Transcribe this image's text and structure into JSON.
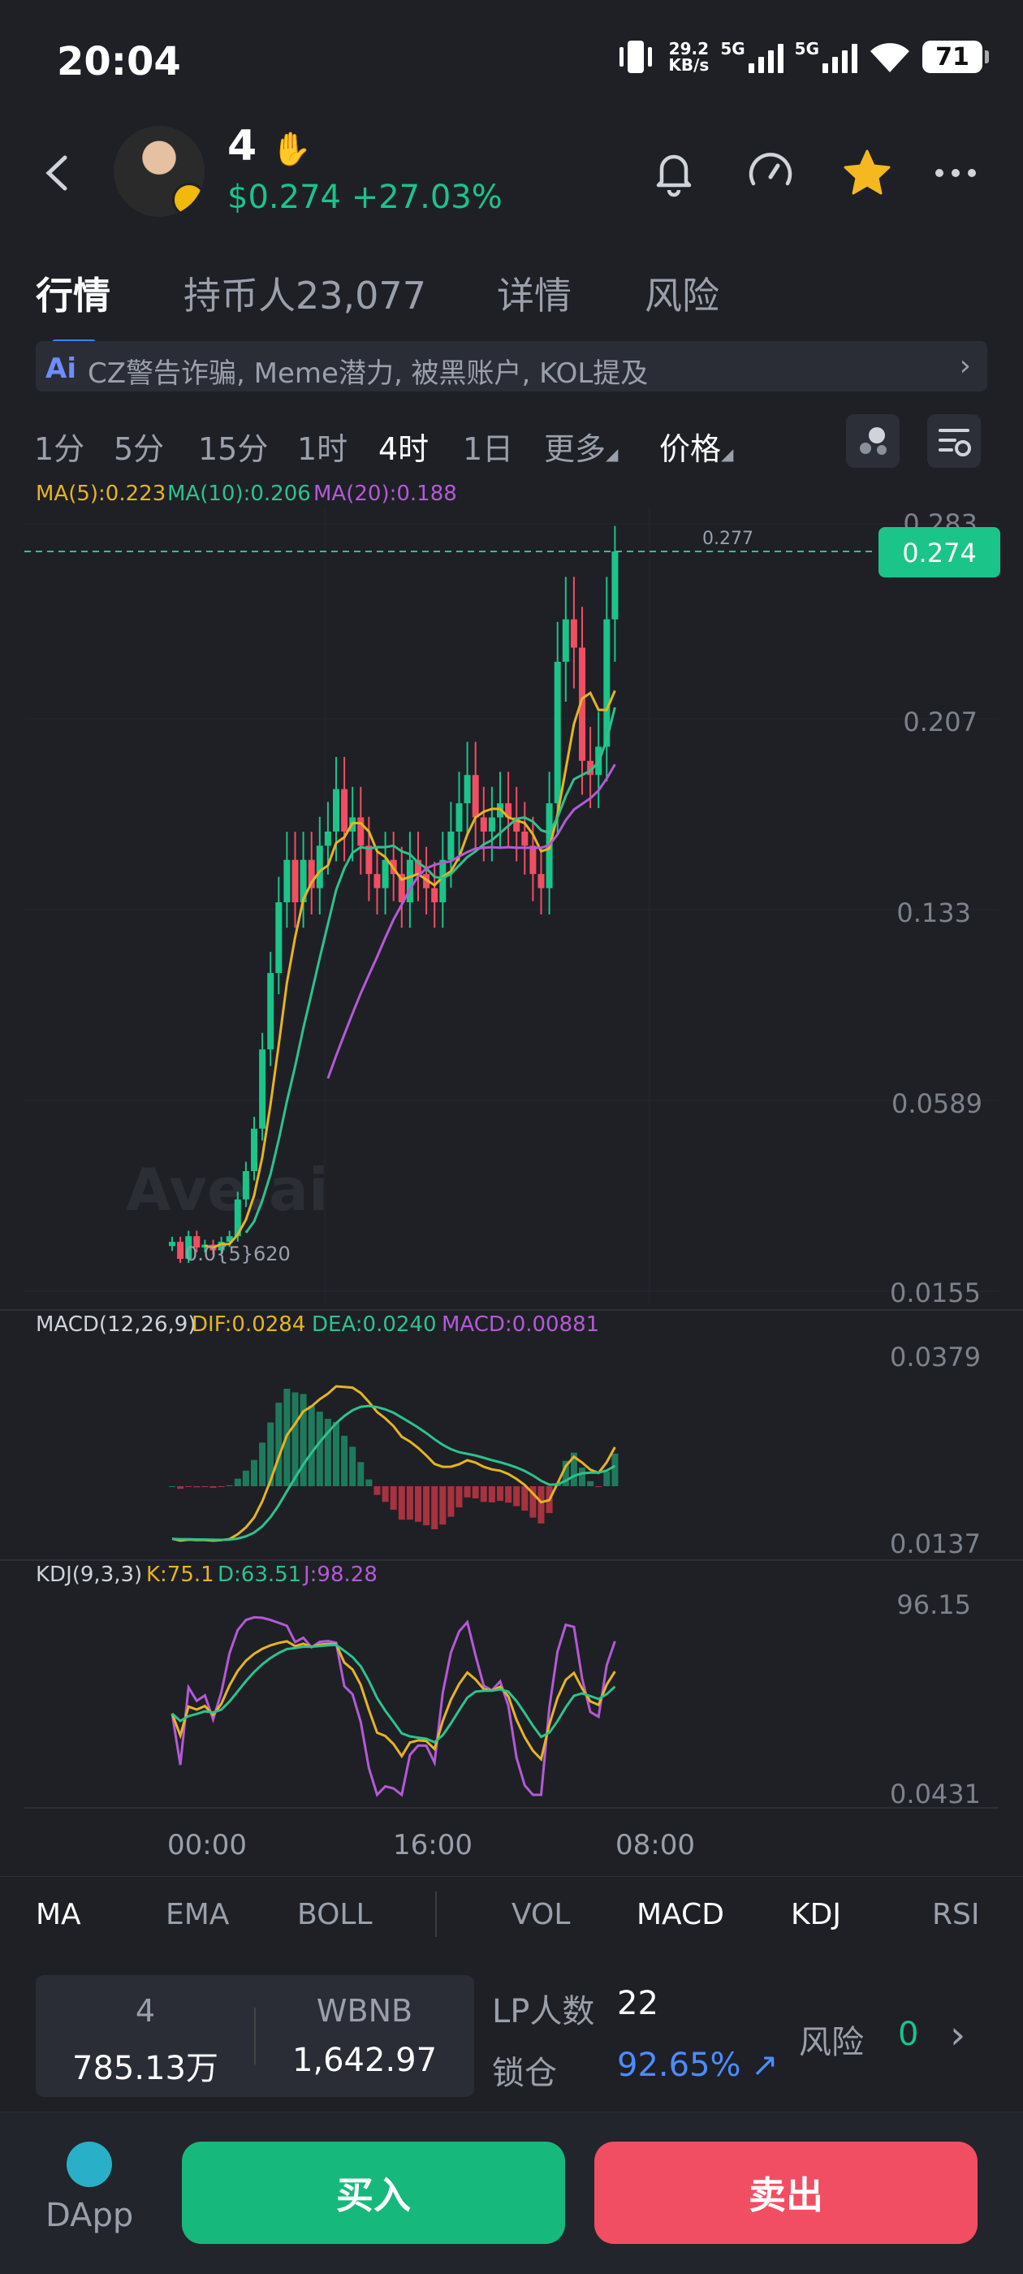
{
  "status_bar": {
    "time": "20:04",
    "net_speed_top": "29.2",
    "net_speed_unit": "KB/s",
    "sig1": "5G",
    "sig2": "5G",
    "battery": "71"
  },
  "header": {
    "token_name": "4",
    "price": "$0.274",
    "change": "+27.03%"
  },
  "tabs": [
    {
      "label": "行情"
    },
    {
      "label": "持币人23,077"
    },
    {
      "label": "详情"
    },
    {
      "label": "风险"
    }
  ],
  "ai_banner": {
    "ai": "Ai",
    "text": "CZ警告诈骗, Meme潜力, 被黑账户, KOL提及"
  },
  "intervals": [
    {
      "label": "1分"
    },
    {
      "label": "5分"
    },
    {
      "label": "15分"
    },
    {
      "label": "1时"
    },
    {
      "label": "4时"
    },
    {
      "label": "1日"
    },
    {
      "label": "更多"
    },
    {
      "label": "价格"
    }
  ],
  "ma_legend": {
    "ma5": "MA(5):0.223",
    "ma10": "MA(10):0.206",
    "ma20": "MA(20):0.188"
  },
  "price_axis": {
    "top": "0.283",
    "t1": "0.207",
    "t2": "0.133",
    "t3": "0.0589",
    "bottom": "0.0155",
    "current": "0.274",
    "high_label": "0.277",
    "low_label": "0.0{5}620",
    "watermark": "Ave.ai"
  },
  "macd_legend": {
    "title": "MACD(12,26,9)",
    "dif": "DIF:0.0284",
    "dea": "DEA:0.0240",
    "macd": "MACD:0.00881",
    "axis_top": "0.0379",
    "axis_bottom": "0.0137"
  },
  "kdj_legend": {
    "title": "KDJ(9,3,3)",
    "k": "K:75.1",
    "d": "D:63.51",
    "j": "J:98.28",
    "axis_top": "96.15",
    "axis_bottom": "0.0431"
  },
  "time_axis": [
    "00:00",
    "16:00",
    "08:00"
  ],
  "indicator_tabs": [
    {
      "label": "MA"
    },
    {
      "label": "EMA"
    },
    {
      "label": "BOLL"
    },
    {
      "label": "VOL"
    },
    {
      "label": "MACD"
    },
    {
      "label": "KDJ"
    },
    {
      "label": "RSI"
    }
  ],
  "pool": {
    "sym_a": "4",
    "amt_a": "785.13万",
    "sym_b": "WBNB",
    "amt_b": "1,642.97"
  },
  "lp_info": {
    "lp_label": "LP人数",
    "lp_value": "22",
    "lock_label": "锁仓",
    "lock_value": "92.65%",
    "risk_label": "风险",
    "risk_value": "0"
  },
  "bottom_nav": {
    "dapp": "DApp",
    "buy": "买入",
    "sell": "卖出"
  },
  "colors": {
    "bg": "#1e2026",
    "up": "#1bc489",
    "down": "#f24e63",
    "ma5": "#e6b422",
    "ma10": "#2ec28b",
    "ma20": "#b45ad6",
    "accent": "#3f7fff"
  },
  "chart_data": {
    "type": "candlestick",
    "interval": "4时",
    "x_ticks": [
      "00:00",
      "16:00",
      "08:00"
    ],
    "ylim": [
      0.0155,
      0.283
    ],
    "candles_close": [
      0.03,
      0.024,
      0.032,
      0.028,
      0.029,
      0.027,
      0.03,
      0.032,
      0.045,
      0.055,
      0.07,
      0.098,
      0.125,
      0.15,
      0.165,
      0.15,
      0.165,
      0.155,
      0.17,
      0.175,
      0.19,
      0.175,
      0.18,
      0.17,
      0.16,
      0.155,
      0.165,
      0.16,
      0.15,
      0.165,
      0.16,
      0.155,
      0.15,
      0.165,
      0.175,
      0.185,
      0.195,
      0.18,
      0.175,
      0.18,
      0.185,
      0.18,
      0.175,
      0.17,
      0.16,
      0.155,
      0.185,
      0.235,
      0.25,
      0.24,
      0.2,
      0.195,
      0.205,
      0.25,
      0.274
    ],
    "ma5_last": 0.223,
    "ma10_last": 0.206,
    "ma20_last": 0.188
  }
}
